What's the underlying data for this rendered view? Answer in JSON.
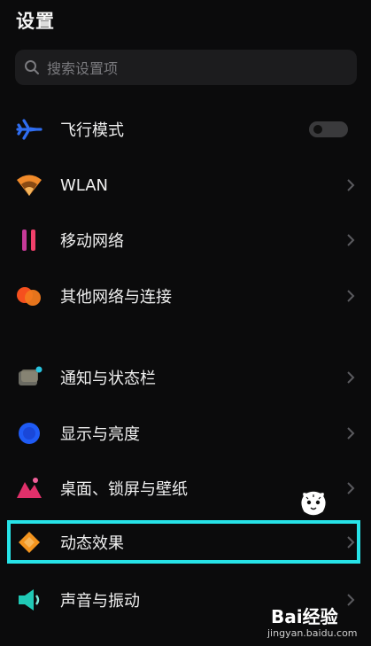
{
  "header": {
    "title": "设置"
  },
  "search": {
    "placeholder": "搜索设置项"
  },
  "settings": {
    "airplane": {
      "label": "飞行模式",
      "enabled": false
    },
    "wlan": {
      "label": "WLAN"
    },
    "mobile": {
      "label": "移动网络"
    },
    "other_network": {
      "label": "其他网络与连接"
    },
    "notify": {
      "label": "通知与状态栏"
    },
    "display": {
      "label": "显示与亮度"
    },
    "desktop": {
      "label": "桌面、锁屏与壁纸"
    },
    "animation": {
      "label": "动态效果",
      "highlighted": true
    },
    "sound": {
      "label": "声音与振动"
    }
  },
  "colors": {
    "highlight": "#27e3e8",
    "airplane_icon": "#2f6df0",
    "wlan_icon": "#f08a2a",
    "mobile_icon": "#e0406a",
    "network_icon": "#f5501e",
    "display_icon": "#1f5bf5",
    "desktop_icon": "#e0306a",
    "animation_icon": "#f3941e",
    "sound_icon": "#20c9b6"
  },
  "watermark": {
    "brand": "Bai经验",
    "site": "jingyan.baidu.com"
  }
}
